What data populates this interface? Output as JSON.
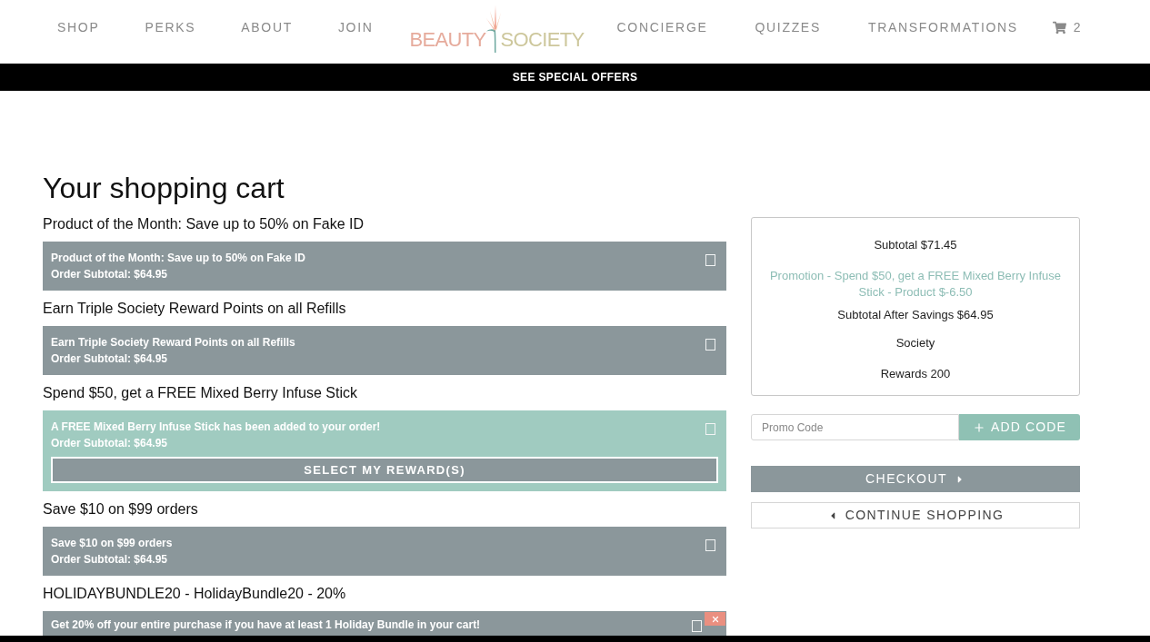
{
  "nav": {
    "left_items": [
      "SHOP",
      "PERKS",
      "ABOUT",
      "JOIN"
    ],
    "logo": {
      "left": "BEAUTY",
      "right": "SOCIETY"
    },
    "right_items": [
      "CONCIERGE",
      "QUIZZES",
      "TRANSFORMATIONS"
    ],
    "cart_count": "2"
  },
  "banner": {
    "label": "SEE SPECIAL OFFERS"
  },
  "page_title": "Your shopping cart",
  "promotions": [
    {
      "kind": "plain",
      "heading": "Product of the Month: Save up to 50% on Fake ID",
      "message": "Product of the Month: Save up to 50% on Fake ID",
      "subtotal": "Order Subtotal: $64.95",
      "checked": false
    },
    {
      "kind": "plain",
      "heading": "Earn Triple Society Reward Points on all Refills",
      "message": "Earn Triple Society Reward Points on all Refills",
      "subtotal": "Order Subtotal: $64.95",
      "checked": false
    },
    {
      "kind": "reward",
      "heading": "Spend $50, get a FREE Mixed Berry Infuse Stick",
      "message": "A FREE Mixed Berry Infuse Stick has been added to your order!",
      "subtotal": "Order Subtotal: $64.95",
      "button": "SELECT MY REWARD(S)",
      "checked": false
    },
    {
      "kind": "plain",
      "heading": "Save $10 on $99 orders",
      "message": "Save $10 on $99 orders",
      "subtotal": "Order Subtotal: $64.95",
      "checked": false
    },
    {
      "kind": "removable",
      "heading": "HOLIDAYBUNDLE20 - HolidayBundle20 - 20%",
      "message": "Get 20% off your entire purchase if you have at least 1 Holiday Bundle in your cart!",
      "checked": false
    }
  ],
  "summary": {
    "subtotal": "Subtotal $71.45",
    "promotion": "Promotion - Spend $50, get a FREE Mixed Berry Infuse Stick - Product $-6.50",
    "after_savings": "Subtotal After Savings $64.95",
    "society": "Society",
    "rewards": "Rewards 200"
  },
  "promo_code": {
    "placeholder": "Promo Code",
    "button": "ADD CODE"
  },
  "checkout": {
    "label": "CHECKOUT"
  },
  "continue_shopping": {
    "label": "CONTINUE SHOPPING"
  }
}
